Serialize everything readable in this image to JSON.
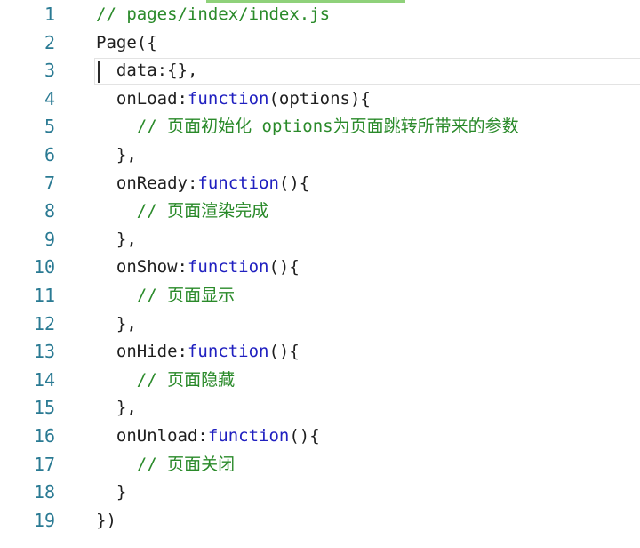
{
  "editor": {
    "lines": [
      {
        "num": "1",
        "indent": "",
        "tokens": [
          {
            "text": "// pages/index/index.js",
            "kind": "comment"
          }
        ]
      },
      {
        "num": "2",
        "indent": "",
        "tokens": [
          {
            "text": "Page({",
            "kind": "plain"
          }
        ]
      },
      {
        "num": "3",
        "indent": "  ",
        "tokens": [
          {
            "text": "data:{},",
            "kind": "plain"
          }
        ]
      },
      {
        "num": "4",
        "indent": "  ",
        "tokens": [
          {
            "text": "onLoad:",
            "kind": "plain"
          },
          {
            "text": "function",
            "kind": "keyword"
          },
          {
            "text": "(options){",
            "kind": "plain"
          }
        ]
      },
      {
        "num": "5",
        "indent": "    ",
        "tokens": [
          {
            "text": "// 页面初始化 options为页面跳转所带来的参数",
            "kind": "comment"
          }
        ]
      },
      {
        "num": "6",
        "indent": "  ",
        "tokens": [
          {
            "text": "},",
            "kind": "plain"
          }
        ]
      },
      {
        "num": "7",
        "indent": "  ",
        "tokens": [
          {
            "text": "onReady:",
            "kind": "plain"
          },
          {
            "text": "function",
            "kind": "keyword"
          },
          {
            "text": "(){",
            "kind": "plain"
          }
        ]
      },
      {
        "num": "8",
        "indent": "    ",
        "tokens": [
          {
            "text": "// 页面渲染完成",
            "kind": "comment"
          }
        ]
      },
      {
        "num": "9",
        "indent": "  ",
        "tokens": [
          {
            "text": "},",
            "kind": "plain"
          }
        ]
      },
      {
        "num": "10",
        "indent": "  ",
        "tokens": [
          {
            "text": "onShow:",
            "kind": "plain"
          },
          {
            "text": "function",
            "kind": "keyword"
          },
          {
            "text": "(){",
            "kind": "plain"
          }
        ]
      },
      {
        "num": "11",
        "indent": "    ",
        "tokens": [
          {
            "text": "// 页面显示",
            "kind": "comment"
          }
        ]
      },
      {
        "num": "12",
        "indent": "  ",
        "tokens": [
          {
            "text": "},",
            "kind": "plain"
          }
        ]
      },
      {
        "num": "13",
        "indent": "  ",
        "tokens": [
          {
            "text": "onHide:",
            "kind": "plain"
          },
          {
            "text": "function",
            "kind": "keyword"
          },
          {
            "text": "(){",
            "kind": "plain"
          }
        ]
      },
      {
        "num": "14",
        "indent": "    ",
        "tokens": [
          {
            "text": "// 页面隐藏",
            "kind": "comment"
          }
        ]
      },
      {
        "num": "15",
        "indent": "  ",
        "tokens": [
          {
            "text": "},",
            "kind": "plain"
          }
        ]
      },
      {
        "num": "16",
        "indent": "  ",
        "tokens": [
          {
            "text": "onUnload:",
            "kind": "plain"
          },
          {
            "text": "function",
            "kind": "keyword"
          },
          {
            "text": "(){",
            "kind": "plain"
          }
        ]
      },
      {
        "num": "17",
        "indent": "    ",
        "tokens": [
          {
            "text": "// 页面关闭",
            "kind": "comment"
          }
        ]
      },
      {
        "num": "18",
        "indent": "  ",
        "tokens": [
          {
            "text": "}",
            "kind": "plain"
          }
        ]
      },
      {
        "num": "19",
        "indent": "",
        "tokens": [
          {
            "text": "})",
            "kind": "plain"
          }
        ]
      }
    ]
  },
  "colors": {
    "line_number": "#2a7a93",
    "comment": "#2a8a2a",
    "keyword": "#2020c0",
    "text": "#1f1f1f",
    "accent": "#8fd17a"
  }
}
